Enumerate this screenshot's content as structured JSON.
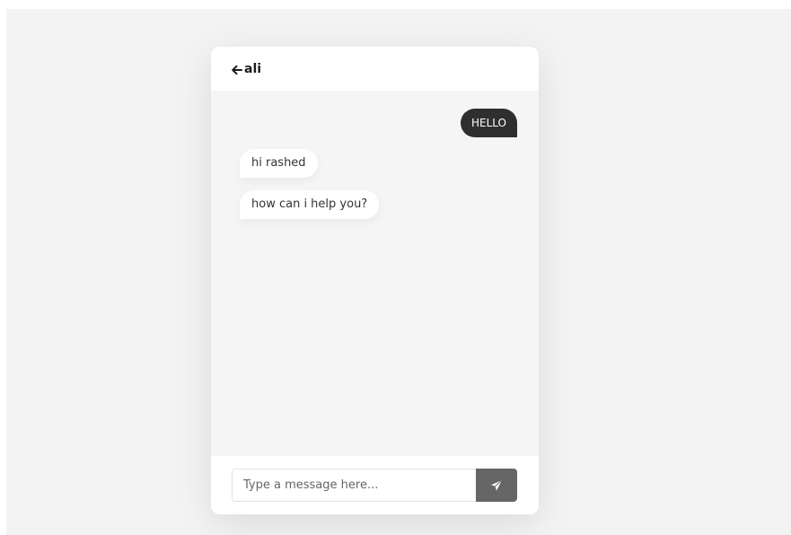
{
  "colors": {
    "page_background": "#f3f3f3",
    "chat_background": "#f5f5f5",
    "header_background": "#ffffff",
    "sent_bubble": "#2f2f2f",
    "received_bubble": "#ffffff",
    "send_button": "#666666"
  },
  "header": {
    "back_icon": "arrow-left-icon",
    "contact_name": "ali"
  },
  "messages": [
    {
      "direction": "sent",
      "text": "HELLO"
    },
    {
      "direction": "received",
      "text": "hi rashed"
    },
    {
      "direction": "received",
      "text": "how can i help you?"
    }
  ],
  "composer": {
    "placeholder": "Type a message here...",
    "value": "",
    "send_icon": "paper-plane-icon"
  }
}
